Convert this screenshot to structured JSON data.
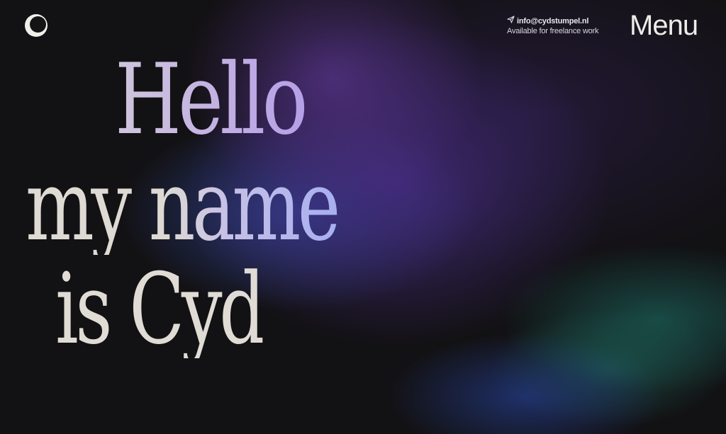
{
  "header": {
    "logo_icon": "crescent-circle-icon",
    "contact": {
      "email": "info@cydstumpel.nl",
      "send_icon": "paper-plane-icon",
      "availability": "Available for freelance work"
    },
    "menu_label": "Menu"
  },
  "hero": {
    "line1": "Hello",
    "line2": "my name",
    "line3": "is Cyd"
  },
  "colors": {
    "background": "#121113",
    "text": "#eeece8",
    "purple_glow": "#46288a",
    "blue_glow": "#344ca8",
    "teal_glow": "#1e786e"
  }
}
